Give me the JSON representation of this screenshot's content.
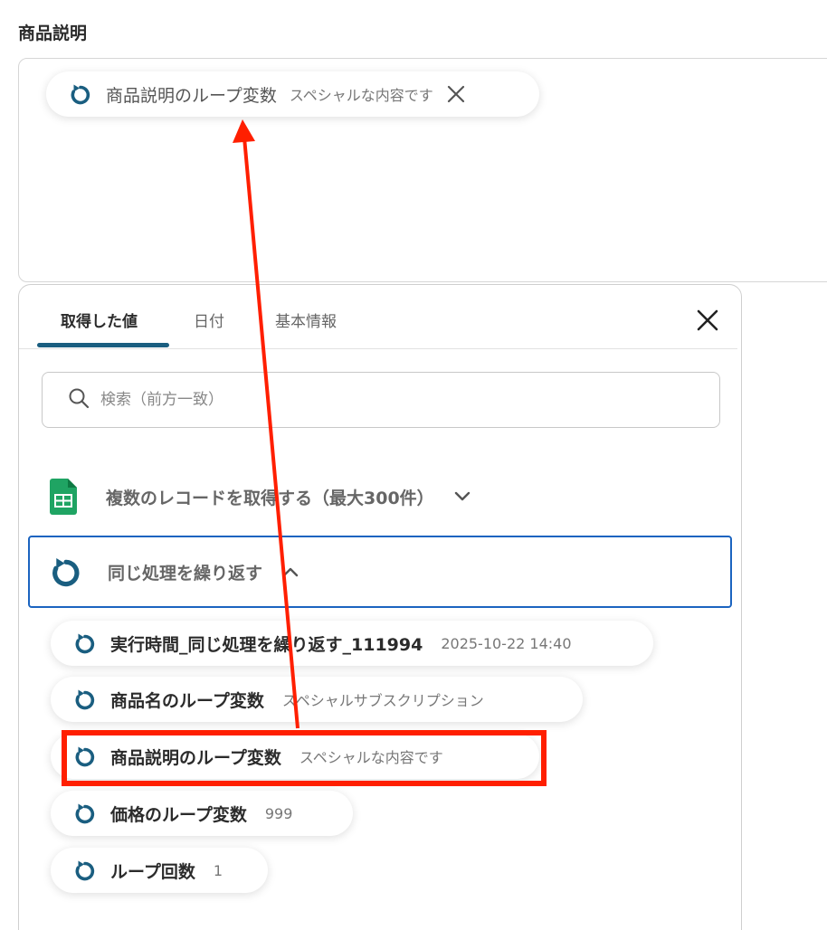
{
  "field": {
    "label": "商品説明"
  },
  "selected_token": {
    "name": "商品説明のループ変数",
    "value": "スペシャルな内容です"
  },
  "panel": {
    "tabs": [
      {
        "label": "取得した値",
        "active": true
      },
      {
        "label": "日付",
        "active": false
      },
      {
        "label": "基本情報",
        "active": false
      }
    ],
    "search_placeholder": "検索（前方一致）",
    "groups": [
      {
        "label": "複数のレコードを取得する（最大300件）",
        "icon": "spreadsheet-icon",
        "expanded": false
      },
      {
        "label": "同じ処理を繰り返す",
        "icon": "loop-icon",
        "expanded": true
      }
    ],
    "items": [
      {
        "name": "実行時間_同じ処理を繰り返す_111994",
        "value": "2025-10-22 14:40"
      },
      {
        "name": "商品名のループ変数",
        "value": "スペシャルサブスクリプション"
      },
      {
        "name": "商品説明のループ変数",
        "value": "スペシャルな内容です",
        "highlighted": true
      },
      {
        "name": "価格のループ変数",
        "value": "999"
      },
      {
        "name": "ループ回数",
        "value": "1"
      }
    ]
  },
  "colors": {
    "accent": "#1a5e80",
    "selection_border": "#1b64c0",
    "annotation_red": "#ff1f00",
    "sheets_green": "#1fa463"
  }
}
